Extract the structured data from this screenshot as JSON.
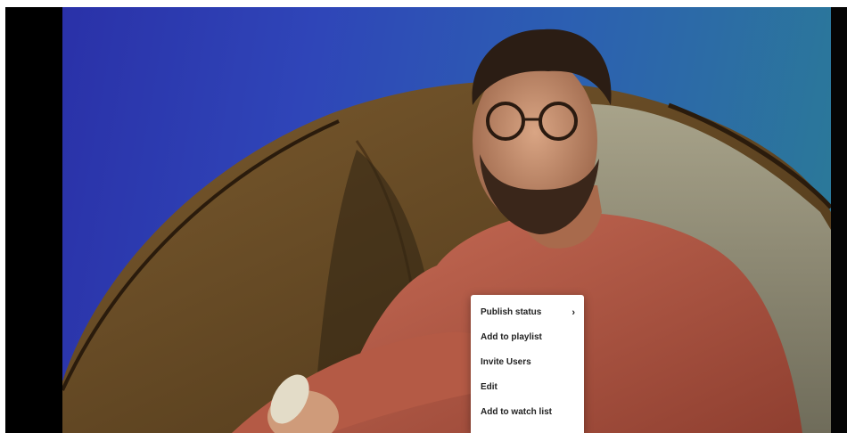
{
  "player": {
    "frame_description_icon": "video-frame"
  },
  "context_menu": {
    "items": [
      {
        "label": "Publish status",
        "has_submenu": true,
        "chevron": "›"
      },
      {
        "label": "Add to playlist",
        "has_submenu": false
      },
      {
        "label": "Invite Users",
        "has_submenu": false
      },
      {
        "label": "Edit",
        "has_submenu": false
      },
      {
        "label": "Add to watch list",
        "has_submenu": false
      }
    ]
  },
  "colors": {
    "menu_bg": "#ffffff",
    "menu_text": "#1f1f1f",
    "letterbox": "#000000"
  }
}
